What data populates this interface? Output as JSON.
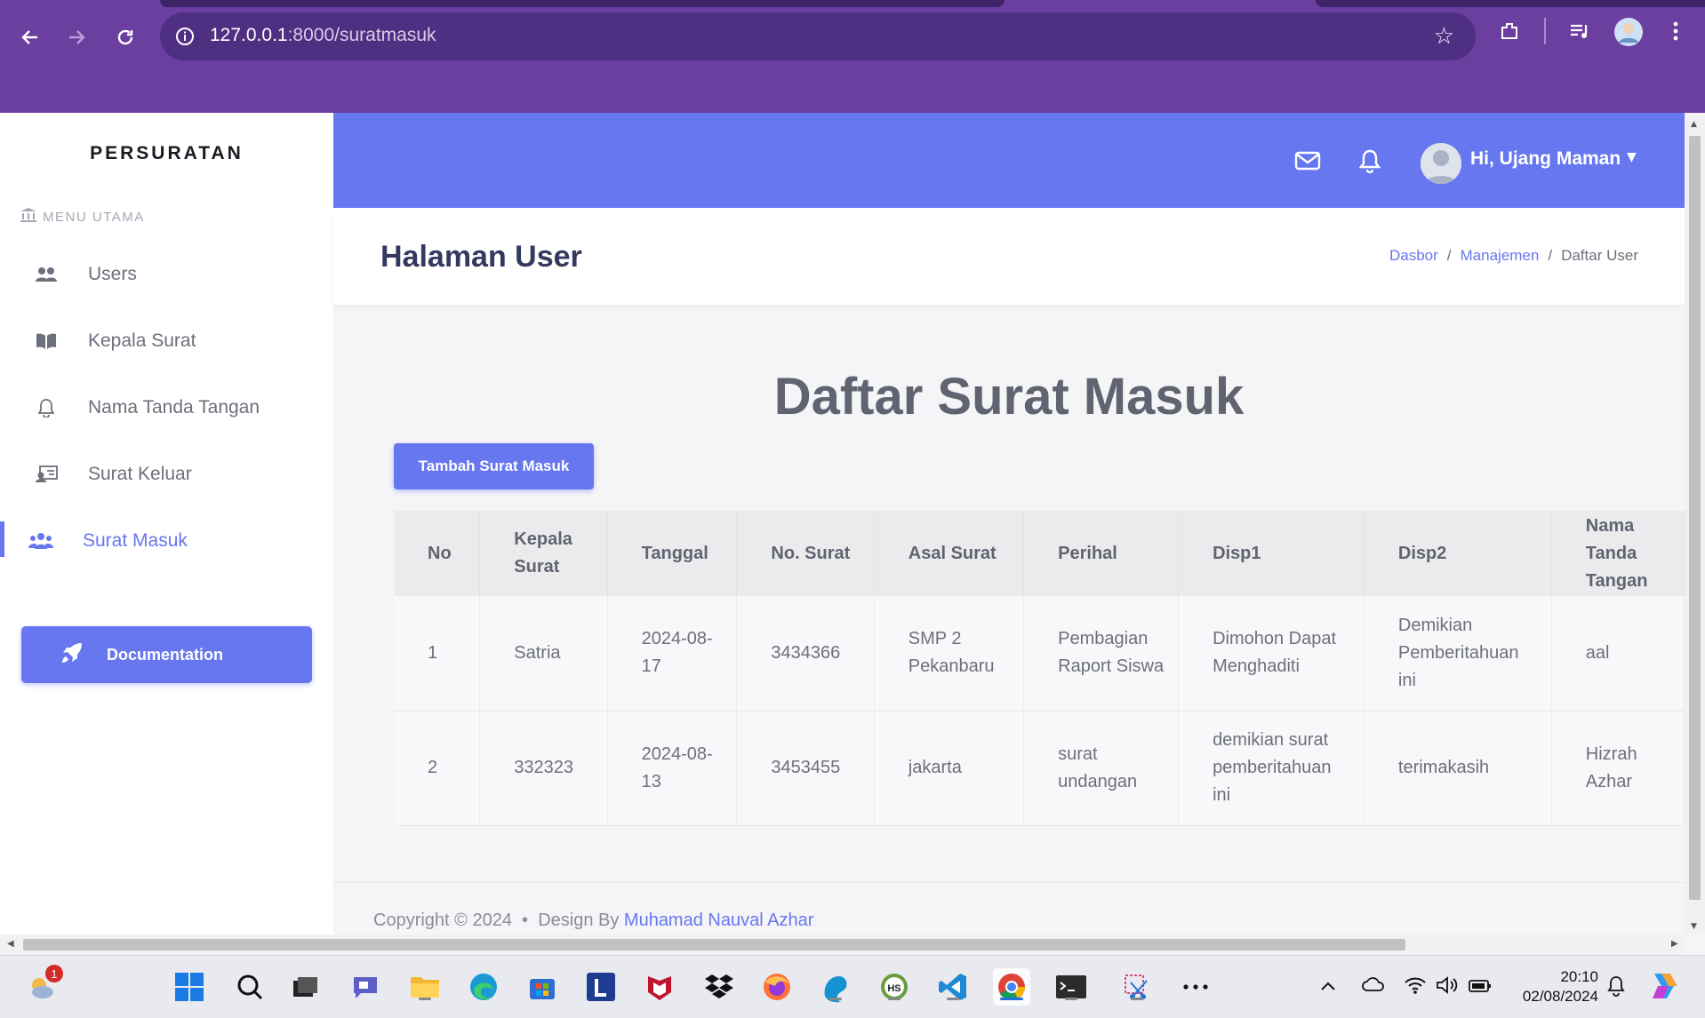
{
  "browser": {
    "url_host": "127.0.0.1",
    "url_path": ":8000/suratmasuk"
  },
  "sidebar": {
    "brand": "PERSURATAN",
    "menu_heading": "MENU UTAMA",
    "items": [
      {
        "label": "Users",
        "icon": "users-icon"
      },
      {
        "label": "Kepala Surat",
        "icon": "book-icon"
      },
      {
        "label": "Nama Tanda Tangan",
        "icon": "bell-icon"
      },
      {
        "label": "Surat Keluar",
        "icon": "id-card-icon"
      },
      {
        "label": "Surat Masuk",
        "icon": "users-icon",
        "active": true
      }
    ],
    "doc_button": "Documentation"
  },
  "navbar": {
    "user_greeting": "Hi, Ujang Maman"
  },
  "header": {
    "title": "Halaman User",
    "breadcrumb": [
      "Dasbor",
      "Manajemen",
      "Daftar User"
    ]
  },
  "main": {
    "heading": "Daftar Surat Masuk",
    "add_button": "Tambah Surat Masuk",
    "table": {
      "columns": [
        "No",
        "Kepala Surat",
        "Tanggal",
        "No. Surat",
        "Asal Surat",
        "Perihal",
        "Disp1",
        "Disp2",
        "Nama Tanda Tangan"
      ],
      "rows": [
        [
          "1",
          "Satria",
          "2024-08-17",
          "3434366",
          "SMP 2 Pekanbaru",
          "Pembagian Raport Siswa",
          "Dimohon Dapat Menghaditi",
          "Demikian Pemberitahuan ini",
          "aal"
        ],
        [
          "2",
          "332323",
          "2024-08-13",
          "3453455",
          "jakarta",
          "surat undangan",
          "demikian surat pemberitahuan ini",
          "terimakasih",
          "Hizrah Azhar"
        ]
      ]
    }
  },
  "footer": {
    "copyright": "Copyright © 2024",
    "design_by": "Design By",
    "author": "Muhamad Nauval Azhar"
  },
  "taskbar": {
    "weather_badge": "1",
    "time": "20:10",
    "date": "02/08/2024"
  },
  "colors": {
    "primary": "#6777ef",
    "chrome": "#6b3fa0"
  }
}
